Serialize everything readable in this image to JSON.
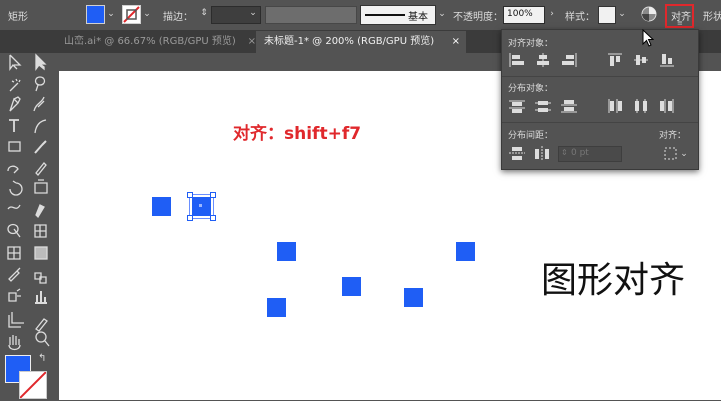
{
  "controlbar": {
    "tool_name": "矩形",
    "stroke_label": "描边：",
    "brush_preset": "基本",
    "opacity_label": "不透明度：",
    "opacity_value": "100%",
    "style_label": "样式：",
    "align_button": "对齐",
    "transform_label": "形状"
  },
  "tabs": [
    {
      "label": "山峦.ai* @ 66.67% (RGB/GPU 预览)",
      "active": false
    },
    {
      "label": "未标题-1* @ 200% (RGB/GPU 预览)",
      "active": true
    }
  ],
  "align_panel": {
    "align_objects_title": "对齐对象：",
    "distribute_objects_title": "分布对象：",
    "distribute_spacing_title": "分布间距：",
    "spacing_value": "0 pt",
    "align_to_title": "对齐："
  },
  "canvas": {
    "shortcut_text": "对齐：shift+f7",
    "caption_text": "图形对齐"
  },
  "colors": {
    "fill": "#1f5ef5",
    "shortcut_red": "#e0282c",
    "highlight_red": "#e0282c",
    "ui_dark": "#535353"
  },
  "icons": {
    "tools": [
      "selection",
      "direct-selection",
      "magic-wand",
      "lasso",
      "pen",
      "curvature",
      "type",
      "line",
      "rectangle",
      "paintbrush",
      "shaper",
      "pencil",
      "rotate",
      "scale",
      "width",
      "free-transform",
      "shape-builder",
      "perspective",
      "mesh",
      "gradient",
      "eyedropper",
      "blend",
      "symbol-sprayer",
      "column-graph",
      "artboard",
      "slice",
      "hand",
      "zoom"
    ]
  }
}
